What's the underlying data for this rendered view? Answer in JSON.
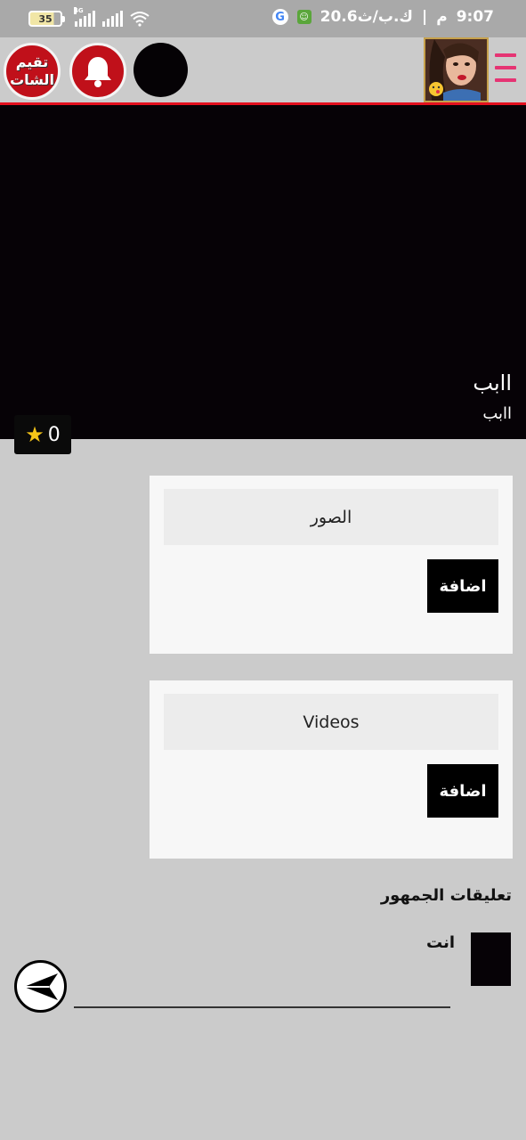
{
  "status_bar": {
    "battery": "35",
    "network_tag": "4G",
    "time": "9:07",
    "am_pm": "م",
    "speed": "20.6",
    "speed_unit": "ك.ب/ث"
  },
  "header": {
    "rate_chat_line1": "تقيم",
    "rate_chat_line2": "الشات",
    "menu_icon": "hamburger-icon",
    "bell_icon": "bell-icon",
    "avatar_desc": "profile-photo"
  },
  "hero": {
    "title": "اابب",
    "subtitle": "اابب",
    "rating": "0"
  },
  "cards": [
    {
      "header": "الصور",
      "add_label": "اضافة"
    },
    {
      "header": "Videos",
      "add_label": "اضافة"
    }
  ],
  "comments": {
    "heading": "تعليقات الجمهور",
    "user_label": "انت",
    "input_value": "",
    "send_icon": "send-icon"
  },
  "colors": {
    "accent_red": "#e3101e",
    "button_red": "#c0101a",
    "menu_pink": "#e63473",
    "star_yellow": "#f5c518"
  }
}
